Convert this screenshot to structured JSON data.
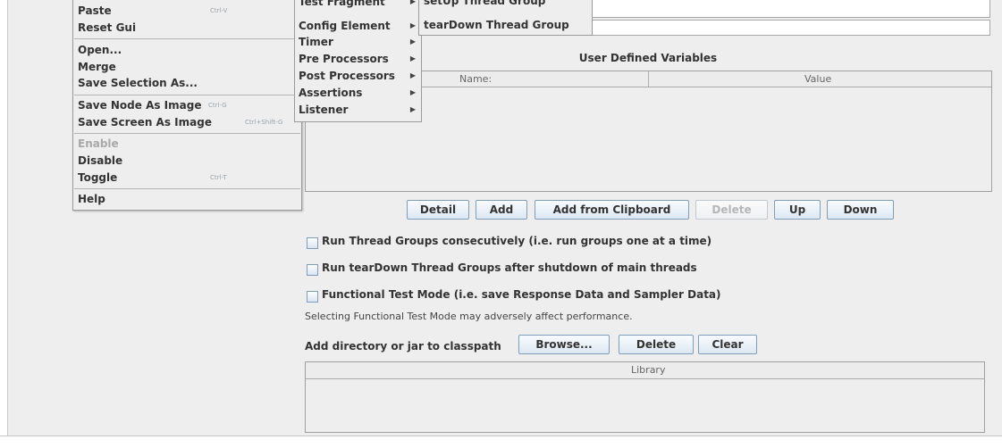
{
  "context_menu": {
    "items": [
      {
        "label": "Paste",
        "shortcut": "Ctrl-V"
      },
      {
        "label": "Reset Gui",
        "shortcut": ""
      },
      {
        "label": "Open...",
        "shortcut": ""
      },
      {
        "label": "Merge",
        "shortcut": ""
      },
      {
        "label": "Save Selection As...",
        "shortcut": ""
      },
      {
        "label": "Save Node As Image",
        "shortcut": "Ctrl-G"
      },
      {
        "label": "Save Screen As Image",
        "shortcut": "Ctrl+Shift-G"
      },
      {
        "label": "Enable",
        "shortcut": ""
      },
      {
        "label": "Disable",
        "shortcut": ""
      },
      {
        "label": "Toggle",
        "shortcut": "Ctrl-T"
      },
      {
        "label": "Help",
        "shortcut": ""
      }
    ]
  },
  "add_submenu": {
    "items": [
      {
        "label": "Test Fragment"
      },
      {
        "label": "Config Element"
      },
      {
        "label": "Timer"
      },
      {
        "label": "Pre Processors"
      },
      {
        "label": "Post Processors"
      },
      {
        "label": "Assertions"
      },
      {
        "label": "Listener"
      }
    ]
  },
  "thread_submenu": {
    "items": [
      {
        "label": "setUp Thread Group"
      },
      {
        "label": "tearDown Thread Group"
      }
    ]
  },
  "variables": {
    "title": "User Defined Variables",
    "columns": [
      "Name:",
      "Value"
    ],
    "buttons": {
      "detail": "Detail",
      "add": "Add",
      "add_clipboard": "Add from Clipboard",
      "delete": "Delete",
      "up": "Up",
      "down": "Down"
    }
  },
  "options": {
    "run_consecutively": "Run Thread Groups consecutively (i.e. run groups one at a time)",
    "run_teardown": "Run tearDown Thread Groups after shutdown of main threads",
    "functional_mode": "Functional Test Mode (i.e. save Response Data and Sampler Data)",
    "perf_note": "Selecting Functional Test Mode may adversely affect performance."
  },
  "classpath": {
    "label": "Add directory or jar to classpath",
    "buttons": {
      "browse": "Browse...",
      "delete": "Delete",
      "clear": "Clear"
    },
    "column": "Library"
  }
}
